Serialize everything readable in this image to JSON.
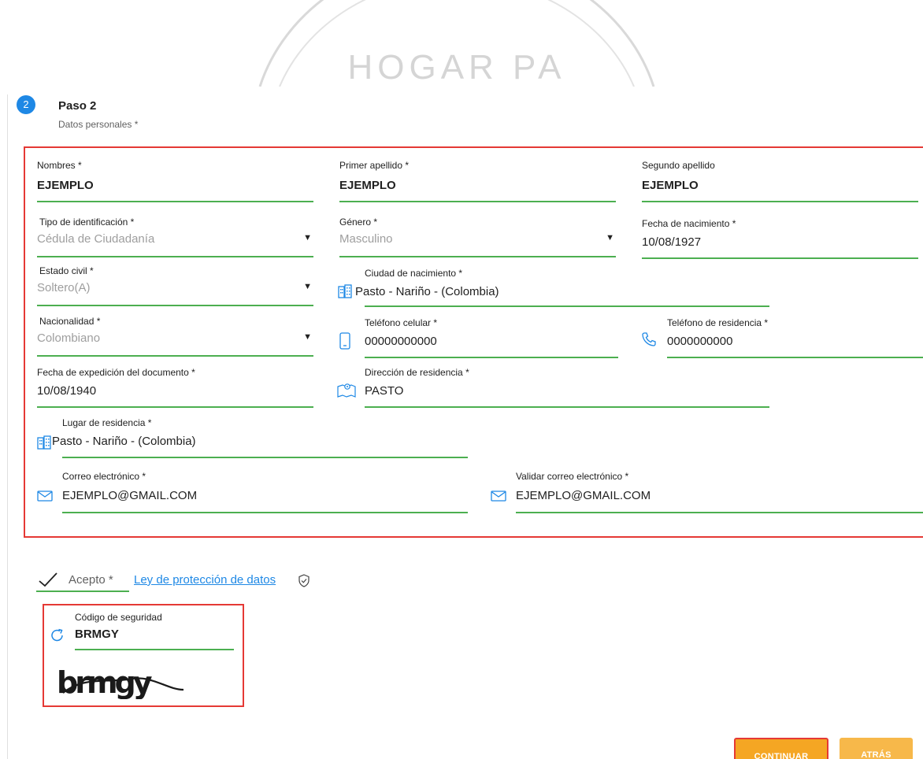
{
  "watermark": {
    "text": "HOGAR PA"
  },
  "step": {
    "number": "2",
    "title": "Paso 2",
    "subtitle": "Datos personales *"
  },
  "form": {
    "nombres": {
      "label": "Nombres *",
      "value": "EJEMPLO"
    },
    "primer_apellido": {
      "label": "Primer apellido *",
      "value": "EJEMPLO"
    },
    "segundo_apellido": {
      "label": "Segundo apellido",
      "value": "EJEMPLO"
    },
    "tipo_id": {
      "label": "Tipo de identificación *",
      "value": "Cédula de Ciudadanía"
    },
    "genero": {
      "label": "Género *",
      "value": "Masculino"
    },
    "fecha_nacimiento": {
      "label": "Fecha de nacimiento *",
      "value": "10/08/1927"
    },
    "estado_civil": {
      "label": "Estado civil *",
      "value": "Soltero(A)"
    },
    "ciudad_nacimiento": {
      "label": "Ciudad de nacimiento *",
      "value": "Pasto - Nariño - (Colombia)"
    },
    "nacionalidad": {
      "label": "Nacionalidad *",
      "value": "Colombiano"
    },
    "telefono_celular": {
      "label": "Teléfono celular *",
      "value": "00000000000"
    },
    "telefono_residencia": {
      "label": "Teléfono de residencia *",
      "value": "0000000000"
    },
    "fecha_expedicion": {
      "label": "Fecha de expedición del documento *",
      "value": "10/08/1940"
    },
    "direccion": {
      "label": "Dirección de residencia *",
      "value": "PASTO"
    },
    "lugar_residencia": {
      "label": "Lugar de residencia *",
      "value": "Pasto - Nariño - (Colombia)"
    },
    "correo": {
      "label": "Correo electrónico *",
      "value": "EJEMPLO@GMAIL.COM"
    },
    "validar_correo": {
      "label": "Validar correo electrónico *",
      "value": "EJEMPLO@GMAIL.COM"
    }
  },
  "consent": {
    "accept_label": "Acepto *",
    "link_text": "Ley de protección de datos"
  },
  "captcha": {
    "label": "Código de seguridad",
    "value": "BRMGY",
    "image_text": "brmgy"
  },
  "buttons": {
    "continue": "CONTINUAR",
    "back": "ATRÁS"
  },
  "colors": {
    "accent": "#4caf50",
    "highlight": "#e53935",
    "primary_blue": "#1e88e5",
    "button": "#f5a623"
  },
  "icons": {
    "select_arrow": "▼"
  }
}
